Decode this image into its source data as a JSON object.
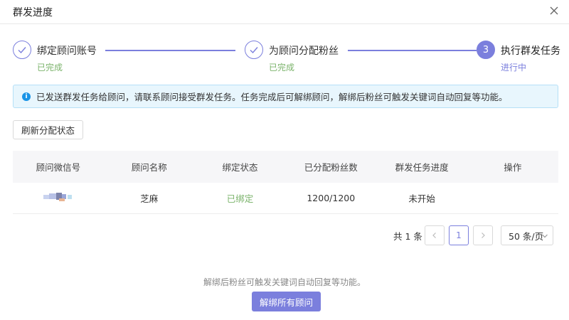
{
  "dialog": {
    "title": "群发进度",
    "close_icon": "close-icon"
  },
  "steps": [
    {
      "number": "",
      "title": "绑定顾问账号",
      "status": "已完成",
      "state": "done"
    },
    {
      "number": "",
      "title": "为顾问分配粉丝",
      "status": "已完成",
      "state": "done"
    },
    {
      "number": "3",
      "title": "执行群发任务",
      "status": "进行中",
      "state": "active"
    }
  ],
  "alert": {
    "icon": "info-icon",
    "text": "已发送群发任务给顾问，请联系顾问接受群发任务。任务完成后可解绑顾问，解绑后粉丝可触发关键词自动回复等功能。"
  },
  "toolbar": {
    "refresh_label": "刷新分配状态"
  },
  "table": {
    "columns": [
      "顾问微信号",
      "顾问名称",
      "绑定状态",
      "已分配粉丝数",
      "群发任务进度",
      "操作"
    ],
    "rows": [
      {
        "wechat_id": "",
        "name": "芝麻",
        "bind_status": "已绑定",
        "fans": "1200/1200",
        "progress": "未开始",
        "action": ""
      }
    ]
  },
  "pagination": {
    "total": "共 1 条",
    "prev": "<",
    "current": "1",
    "next": ">",
    "page_size": "50 条/页"
  },
  "footer": {
    "hint": "解绑后粉丝可触发关键词自动回复等功能。",
    "unbind_label": "解绑所有顾问"
  },
  "colors": {
    "accent": "#7b7fdd",
    "success": "#7bb36b",
    "info": "#1a94e6",
    "alert_bg": "#e8f6fd"
  }
}
